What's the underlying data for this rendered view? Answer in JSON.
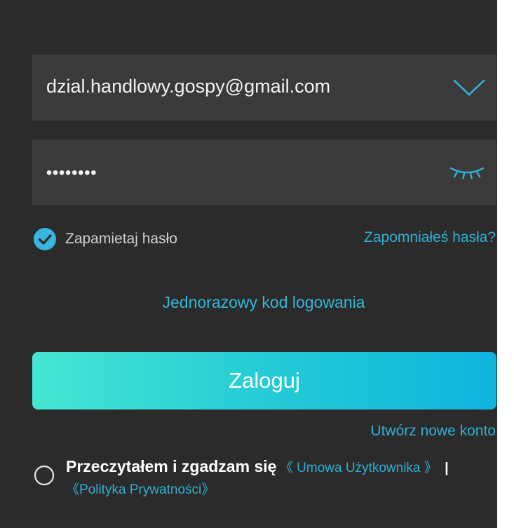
{
  "login": {
    "email_value": "dzial.handlowy.gospy@gmail.com",
    "password_mask": "••••••••",
    "remember_label": "Zapamietaj hasło",
    "forgot_link": "Zapomniałeś hasła?",
    "otp_link": "Jednorazowy kod logowania",
    "login_button": "Zaloguj",
    "signup_link": "Utwórz nowe konto",
    "agreement": {
      "main": "Przeczytałem i zgadzam się",
      "terms_link": "《 Umowa Użytkownika 》",
      "separator": "|",
      "privacy_link": "《Polityka Prywatności》"
    }
  },
  "icons": {
    "dropdown": "chevron-down-icon",
    "password_visibility": "eye-closed-icon",
    "remember_checkbox": "checkmark-circle-icon",
    "agree_radio": "radio-circle-icon"
  },
  "colors": {
    "background": "#2b2b2b",
    "field_background": "#3a3a3a",
    "accent": "#2fb0d3",
    "button_gradient_start": "#46e6d3",
    "button_gradient_end": "#0fb4de",
    "text": "#f2f2f2"
  }
}
